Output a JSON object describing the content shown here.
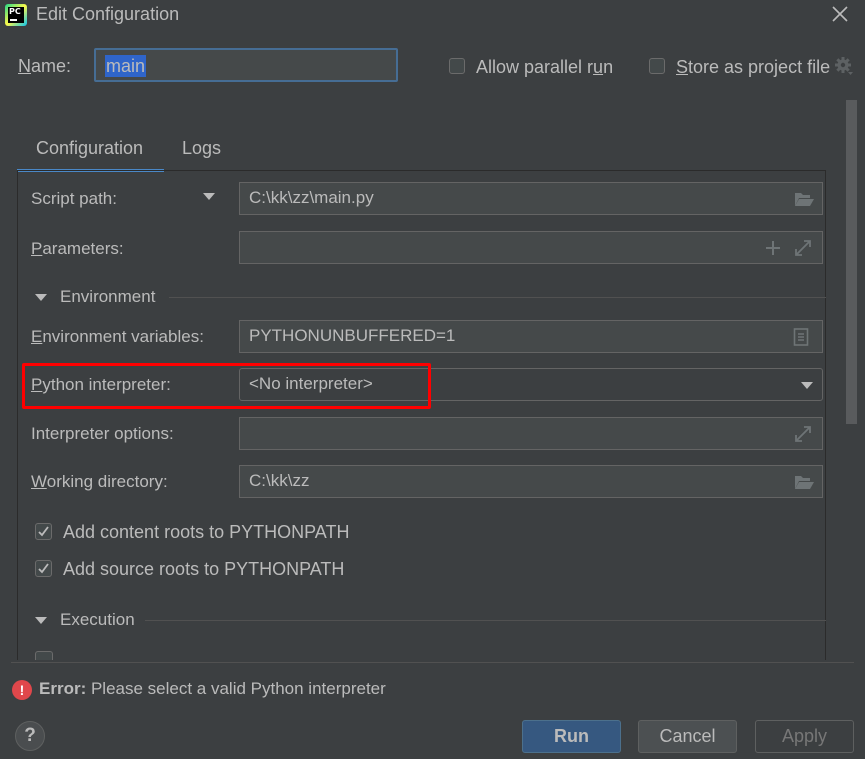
{
  "window": {
    "title": "Edit Configuration",
    "app_icon": "pycharm-logo-icon",
    "app_icon_text": "PC",
    "close_icon": "close-icon"
  },
  "header": {
    "name_label_prefix": "",
    "name_label_mnemonic": "N",
    "name_label_rest": "ame:",
    "name_value": "main",
    "allow_parallel": {
      "label_before": "Allow parallel r",
      "label_mnemonic": "u",
      "label_after": "n",
      "checked": false
    },
    "store_as_project": {
      "label_mnemonic": "S",
      "label_after": "tore as project file",
      "checked": false
    },
    "settings_icon": "gear-icon"
  },
  "tabs": [
    {
      "label": "Configuration",
      "active": true
    },
    {
      "label": "Logs",
      "active": false
    }
  ],
  "form": {
    "script_path": {
      "label": "Script path:",
      "value": "C:\\kk\\zz\\main.py",
      "icon": "folder-open-icon"
    },
    "parameters": {
      "label_mnemonic": "P",
      "label_rest": "arameters:",
      "value": "",
      "icons": [
        "plus-icon",
        "expand-icon"
      ]
    },
    "environment_section": {
      "title": "Environment",
      "expanded": true
    },
    "environment_variables": {
      "label_mnemonic": "E",
      "label_rest": "nvironment variables:",
      "value": "PYTHONUNBUFFERED=1",
      "icon": "document-icon"
    },
    "python_interpreter": {
      "label_mnemonic": "P",
      "label_rest": "ython interpreter:",
      "value": "<No interpreter>",
      "highlight_color": "#ff0000"
    },
    "interpreter_options": {
      "label": "Interpreter options:",
      "value": "",
      "icon": "expand-icon"
    },
    "working_directory": {
      "label_mnemonic": "W",
      "label_rest": "orking directory:",
      "value": "C:\\kk\\zz",
      "icon": "folder-open-icon"
    },
    "add_content_roots": {
      "label": "Add content roots to PYTHONPATH",
      "checked": true
    },
    "add_source_roots": {
      "label": "Add source roots to PYTHONPATH",
      "checked": true
    },
    "execution_section": {
      "title": "Execution",
      "expanded": true
    }
  },
  "status": {
    "error_prefix": "Error:",
    "error_message": " Please select a valid Python interpreter",
    "error_color": "#e0474b"
  },
  "footer": {
    "help_label": "?",
    "run_label": "Run",
    "cancel_label": "Cancel",
    "apply_label": "Apply",
    "apply_enabled": false
  },
  "colors": {
    "background": "#3c3f41",
    "accent": "#4a88c7",
    "primary_button": "#365880",
    "selection": "#2f65ca"
  }
}
